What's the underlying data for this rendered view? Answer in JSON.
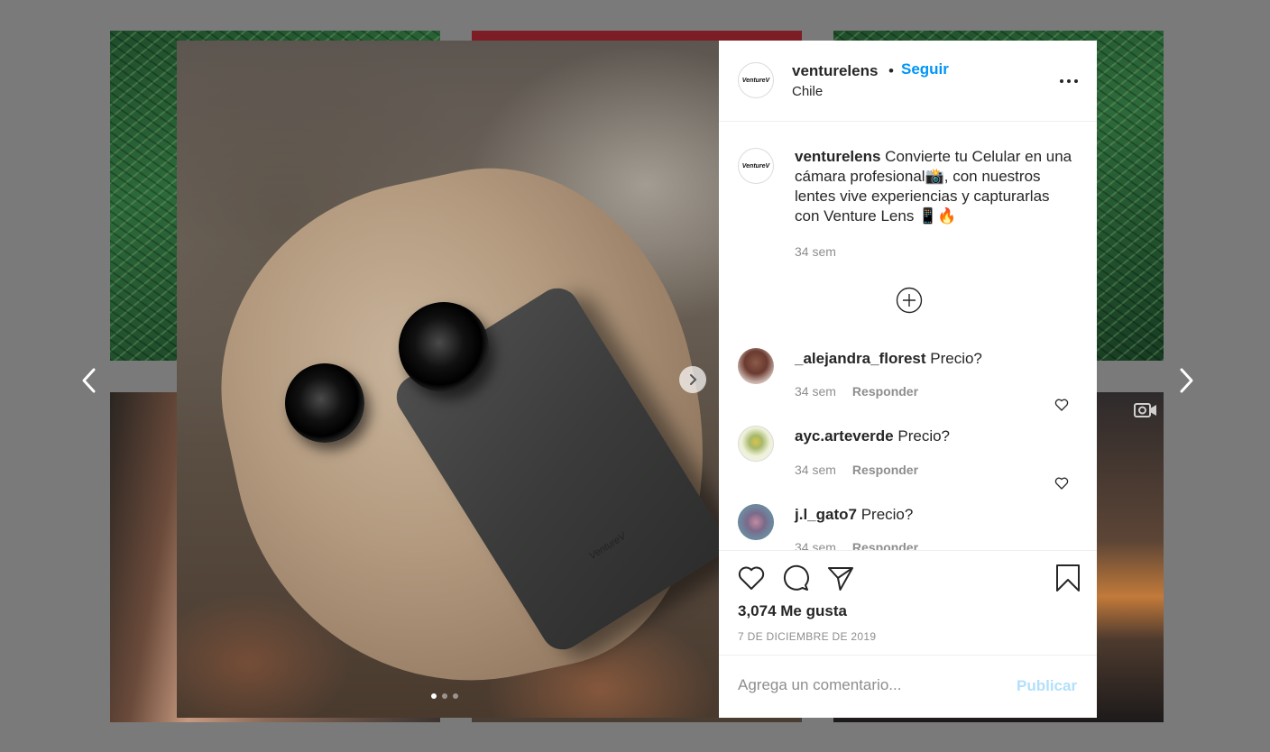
{
  "post": {
    "username": "venturelens",
    "separator": "•",
    "follow_label": "Seguir",
    "location": "Chile",
    "logo_text": "VentureV",
    "phone_brand": "VentureV"
  },
  "caption": {
    "username": "venturelens",
    "text": "Convierte tu Celular en una cámara profesional📸, con nuestros lentes vive experiencias y capturarlas con Venture Lens 📱🔥",
    "time": "34 sem"
  },
  "comments": [
    {
      "username": "_alejandra_florest",
      "text": "Precio?",
      "time": "34 sem",
      "reply_label": "Responder"
    },
    {
      "username": "ayc.arteverde",
      "text": "Precio?",
      "time": "34 sem",
      "reply_label": "Responder"
    },
    {
      "username": "j.l_gato7",
      "text": "Precio?",
      "time": "34 sem",
      "reply_label": "Responder"
    }
  ],
  "likes": "3,074 Me gusta",
  "date": "7 DE DICIEMBRE DE 2019",
  "composer": {
    "placeholder": "Agrega un comentario...",
    "post_label": "Publicar"
  },
  "carousel": {
    "slides": 3,
    "active": 1
  },
  "colors": {
    "accent": "#0095f6",
    "post_disabled": "#b2dffc",
    "muted": "#8e8e8e"
  },
  "icons": [
    "chevron-left-icon",
    "chevron-right-icon",
    "more-icon",
    "add-circle-icon",
    "heart-icon",
    "comment-icon",
    "share-icon",
    "bookmark-icon",
    "video-icon"
  ]
}
